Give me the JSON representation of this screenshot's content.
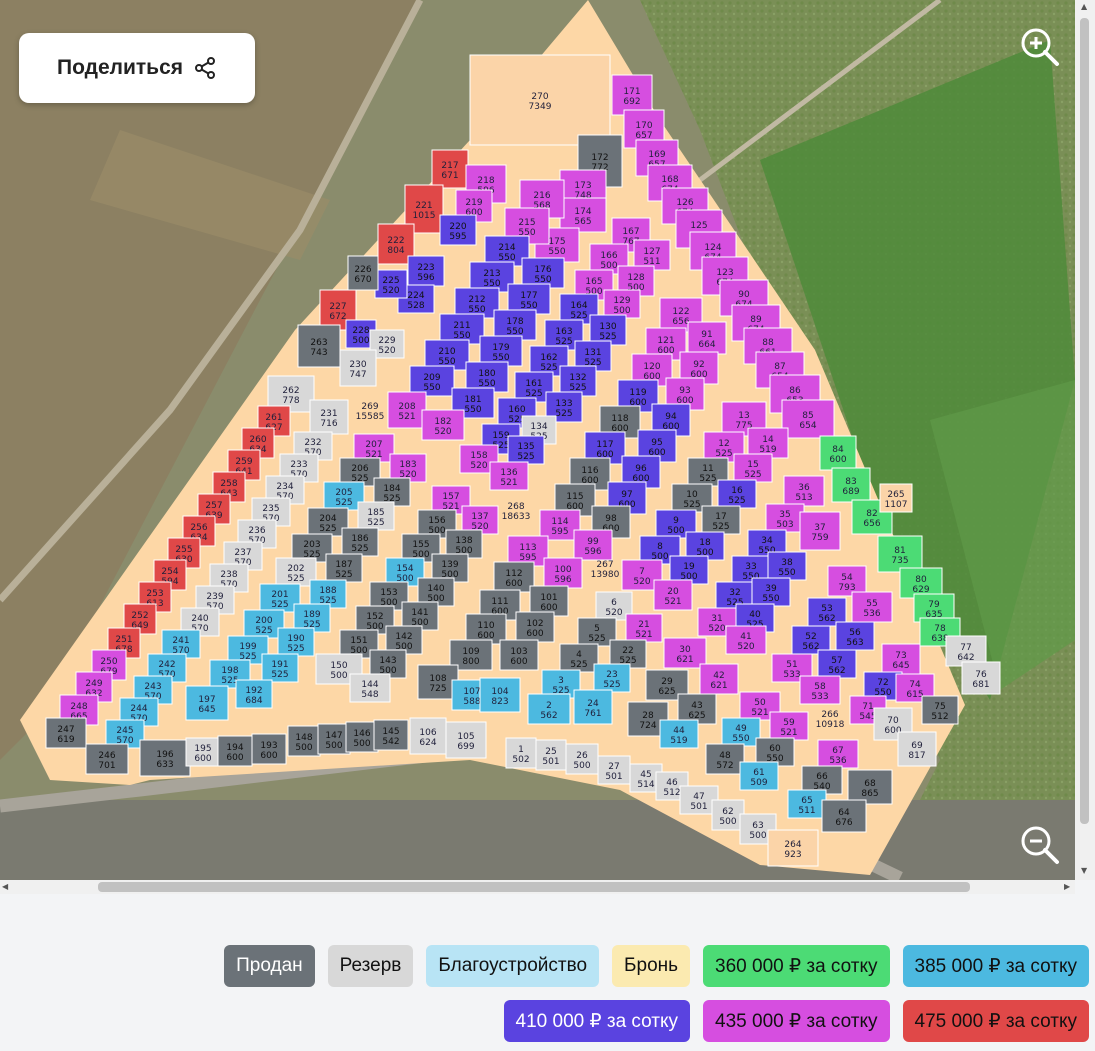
{
  "share": {
    "label": "Поделиться"
  },
  "legend": {
    "row1": [
      {
        "label": "Продан",
        "color": "#6b7278",
        "dark": true
      },
      {
        "label": "Резерв",
        "color": "#d8d8d8",
        "dark": false
      },
      {
        "label": "Благоустройство",
        "color": "#b8e4f5",
        "dark": false
      },
      {
        "label": "Бронь",
        "color": "#fbeab0",
        "dark": false
      },
      {
        "label": "360 000 ₽ за сотку",
        "color": "#4cdb75",
        "dark": false
      },
      {
        "label": "385 000 ₽ за сотку",
        "color": "#4cb9e0",
        "dark": false
      }
    ],
    "row2": [
      {
        "label": "410 000 ₽ за сотку",
        "color": "#5a43e0",
        "dark": true
      },
      {
        "label": "435 000 ₽ за сотку",
        "color": "#d64ee0",
        "dark": false
      },
      {
        "label": "475 000 ₽ за сотку",
        "color": "#e04848",
        "dark": false
      }
    ]
  },
  "colors": {
    "sold": "#6b7278",
    "reserve": "#d8d8d8",
    "booked": "#fbd4a8",
    "p360": "#4cdb75",
    "p385": "#4cb9e0",
    "p410": "#5a43e0",
    "p435": "#d64ee0",
    "p475": "#e04848"
  },
  "plots": [
    {
      "n": "270",
      "a": "7349",
      "s": "booked"
    },
    {
      "n": "171",
      "a": "692",
      "s": "p435"
    },
    {
      "n": "170",
      "a": "657",
      "s": "p435"
    },
    {
      "n": "169",
      "a": "657",
      "s": "p435"
    },
    {
      "n": "168",
      "a": "674",
      "s": "p435"
    },
    {
      "n": "126",
      "a": "674",
      "s": "p435"
    },
    {
      "n": "125",
      "a": "674",
      "s": "p435"
    },
    {
      "n": "124",
      "a": "674",
      "s": "p435"
    },
    {
      "n": "123",
      "a": "674",
      "s": "p435"
    },
    {
      "n": "90",
      "a": "674",
      "s": "p435"
    },
    {
      "n": "89",
      "a": "674",
      "s": "p435"
    },
    {
      "n": "88",
      "a": "661",
      "s": "p435"
    },
    {
      "n": "87",
      "a": "654",
      "s": "p435"
    },
    {
      "n": "86",
      "a": "653",
      "s": "p435"
    },
    {
      "n": "85",
      "a": "654",
      "s": "p435"
    },
    {
      "n": "172",
      "a": "772",
      "s": "sold"
    },
    {
      "n": "173",
      "a": "748",
      "s": "p435"
    },
    {
      "n": "174",
      "a": "565",
      "s": "p435"
    },
    {
      "n": "175",
      "a": "550",
      "s": "p435"
    },
    {
      "n": "216",
      "a": "568",
      "s": "p435"
    },
    {
      "n": "215",
      "a": "550",
      "s": "p435"
    },
    {
      "n": "217",
      "a": "671",
      "s": "p475"
    },
    {
      "n": "218",
      "a": "596",
      "s": "p435"
    },
    {
      "n": "219",
      "a": "600",
      "s": "p435"
    },
    {
      "n": "221",
      "a": "1015",
      "s": "p475"
    },
    {
      "n": "220",
      "a": "595",
      "s": "p410"
    },
    {
      "n": "222",
      "a": "804",
      "s": "p475"
    },
    {
      "n": "223",
      "a": "596",
      "s": "p410"
    },
    {
      "n": "224",
      "a": "528",
      "s": "p410"
    },
    {
      "n": "225",
      "a": "520",
      "s": "p410"
    },
    {
      "n": "226",
      "a": "670",
      "s": "sold"
    },
    {
      "n": "227",
      "a": "672",
      "s": "p475"
    },
    {
      "n": "228",
      "a": "500",
      "s": "p410"
    },
    {
      "n": "229",
      "a": "520",
      "s": "reserve"
    },
    {
      "n": "230",
      "a": "747",
      "s": "reserve"
    },
    {
      "n": "263",
      "a": "743",
      "s": "sold"
    },
    {
      "n": "214",
      "a": "550",
      "s": "p410"
    },
    {
      "n": "176",
      "a": "550",
      "s": "p410"
    },
    {
      "n": "213",
      "a": "550",
      "s": "p410"
    },
    {
      "n": "177",
      "a": "550",
      "s": "p410"
    },
    {
      "n": "212",
      "a": "550",
      "s": "p410"
    },
    {
      "n": "178",
      "a": "550",
      "s": "p410"
    },
    {
      "n": "211",
      "a": "550",
      "s": "p410"
    },
    {
      "n": "179",
      "a": "550",
      "s": "p410"
    },
    {
      "n": "210",
      "a": "550",
      "s": "p410"
    },
    {
      "n": "180",
      "a": "550",
      "s": "p410"
    },
    {
      "n": "209",
      "a": "550",
      "s": "p410"
    },
    {
      "n": "181",
      "a": "550",
      "s": "p410"
    },
    {
      "n": "208",
      "a": "521",
      "s": "p435"
    },
    {
      "n": "182",
      "a": "520",
      "s": "p435"
    },
    {
      "n": "167",
      "a": "767",
      "s": "p435"
    },
    {
      "n": "127",
      "a": "511",
      "s": "p435"
    },
    {
      "n": "166",
      "a": "500",
      "s": "p435"
    },
    {
      "n": "128",
      "a": "500",
      "s": "p435"
    },
    {
      "n": "165",
      "a": "500",
      "s": "p435"
    },
    {
      "n": "129",
      "a": "500",
      "s": "p435"
    },
    {
      "n": "164",
      "a": "525",
      "s": "p410"
    },
    {
      "n": "130",
      "a": "525",
      "s": "p410"
    },
    {
      "n": "163",
      "a": "525",
      "s": "p410"
    },
    {
      "n": "131",
      "a": "525",
      "s": "p410"
    },
    {
      "n": "162",
      "a": "525",
      "s": "p410"
    },
    {
      "n": "132",
      "a": "525",
      "s": "p410"
    },
    {
      "n": "161",
      "a": "525",
      "s": "p410"
    },
    {
      "n": "133",
      "a": "525",
      "s": "p410"
    },
    {
      "n": "160",
      "a": "525",
      "s": "p410"
    },
    {
      "n": "134",
      "a": "525",
      "s": "reserve"
    },
    {
      "n": "159",
      "a": "525",
      "s": "p410"
    },
    {
      "n": "135",
      "a": "525",
      "s": "p410"
    },
    {
      "n": "158",
      "a": "520",
      "s": "p435"
    },
    {
      "n": "136",
      "a": "521",
      "s": "p435"
    },
    {
      "n": "122",
      "a": "656",
      "s": "p435"
    },
    {
      "n": "91",
      "a": "664",
      "s": "p435"
    },
    {
      "n": "121",
      "a": "600",
      "s": "p435"
    },
    {
      "n": "92",
      "a": "600",
      "s": "p435"
    },
    {
      "n": "120",
      "a": "600",
      "s": "p435"
    },
    {
      "n": "93",
      "a": "600",
      "s": "p435"
    },
    {
      "n": "119",
      "a": "600",
      "s": "p410"
    },
    {
      "n": "94",
      "a": "600",
      "s": "p410"
    },
    {
      "n": "118",
      "a": "600",
      "s": "sold"
    },
    {
      "n": "95",
      "a": "600",
      "s": "p410"
    },
    {
      "n": "117",
      "a": "600",
      "s": "p410"
    },
    {
      "n": "96",
      "a": "600",
      "s": "p410"
    },
    {
      "n": "116",
      "a": "600",
      "s": "sold"
    },
    {
      "n": "97",
      "a": "600",
      "s": "p410"
    },
    {
      "n": "115",
      "a": "600",
      "s": "sold"
    },
    {
      "n": "98",
      "a": "600",
      "s": "sold"
    },
    {
      "n": "114",
      "a": "595",
      "s": "p435"
    },
    {
      "n": "99",
      "a": "596",
      "s": "p435"
    },
    {
      "n": "262",
      "a": "778",
      "s": "reserve"
    },
    {
      "n": "231",
      "a": "716",
      "s": "reserve"
    },
    {
      "n": "261",
      "a": "627",
      "s": "p475"
    },
    {
      "n": "232",
      "a": "570",
      "s": "reserve"
    },
    {
      "n": "260",
      "a": "634",
      "s": "p475"
    },
    {
      "n": "233",
      "a": "570",
      "s": "reserve"
    },
    {
      "n": "259",
      "a": "641",
      "s": "p475"
    },
    {
      "n": "234",
      "a": "570",
      "s": "reserve"
    },
    {
      "n": "258",
      "a": "643",
      "s": "p475"
    },
    {
      "n": "235",
      "a": "570",
      "s": "reserve"
    },
    {
      "n": "257",
      "a": "639",
      "s": "p475"
    },
    {
      "n": "236",
      "a": "570",
      "s": "reserve"
    },
    {
      "n": "256",
      "a": "634",
      "s": "p475"
    },
    {
      "n": "237",
      "a": "570",
      "s": "reserve"
    },
    {
      "n": "255",
      "a": "630",
      "s": "p475"
    },
    {
      "n": "238",
      "a": "570",
      "s": "reserve"
    },
    {
      "n": "254",
      "a": "594",
      "s": "p475"
    },
    {
      "n": "239",
      "a": "570",
      "s": "reserve"
    },
    {
      "n": "253",
      "a": "613",
      "s": "p475"
    },
    {
      "n": "240",
      "a": "570",
      "s": "reserve"
    },
    {
      "n": "252",
      "a": "649",
      "s": "p475"
    },
    {
      "n": "241",
      "a": "570",
      "s": "p385"
    },
    {
      "n": "251",
      "a": "678",
      "s": "p475"
    },
    {
      "n": "242",
      "a": "570",
      "s": "p385"
    },
    {
      "n": "250",
      "a": "679",
      "s": "p435"
    },
    {
      "n": "243",
      "a": "570",
      "s": "p385"
    },
    {
      "n": "249",
      "a": "632",
      "s": "p435"
    },
    {
      "n": "244",
      "a": "570",
      "s": "p385"
    },
    {
      "n": "248",
      "a": "665",
      "s": "p435"
    },
    {
      "n": "245",
      "a": "570",
      "s": "p385"
    },
    {
      "n": "247",
      "a": "619",
      "s": "sold"
    },
    {
      "n": "246",
      "a": "701",
      "s": "sold"
    },
    {
      "n": "207",
      "a": "521",
      "s": "p435"
    },
    {
      "n": "183",
      "a": "520",
      "s": "p435"
    },
    {
      "n": "206",
      "a": "525",
      "s": "sold"
    },
    {
      "n": "184",
      "a": "525",
      "s": "sold"
    },
    {
      "n": "205",
      "a": "525",
      "s": "p385"
    },
    {
      "n": "185",
      "a": "525",
      "s": "reserve"
    },
    {
      "n": "204",
      "a": "525",
      "s": "sold"
    },
    {
      "n": "186",
      "a": "525",
      "s": "sold"
    },
    {
      "n": "203",
      "a": "525",
      "s": "sold"
    },
    {
      "n": "187",
      "a": "525",
      "s": "sold"
    },
    {
      "n": "202",
      "a": "525",
      "s": "reserve"
    },
    {
      "n": "188",
      "a": "525",
      "s": "p385"
    },
    {
      "n": "201",
      "a": "525",
      "s": "p385"
    },
    {
      "n": "189",
      "a": "525",
      "s": "p385"
    },
    {
      "n": "200",
      "a": "525",
      "s": "p385"
    },
    {
      "n": "190",
      "a": "525",
      "s": "p385"
    },
    {
      "n": "199",
      "a": "525",
      "s": "p385"
    },
    {
      "n": "191",
      "a": "525",
      "s": "p385"
    },
    {
      "n": "198",
      "a": "525",
      "s": "p385"
    },
    {
      "n": "192",
      "a": "684",
      "s": "p385"
    },
    {
      "n": "197",
      "a": "645",
      "s": "p385"
    },
    {
      "n": "157",
      "a": "521",
      "s": "p435"
    },
    {
      "n": "137",
      "a": "520",
      "s": "p435"
    },
    {
      "n": "156",
      "a": "500",
      "s": "sold"
    },
    {
      "n": "138",
      "a": "500",
      "s": "sold"
    },
    {
      "n": "155",
      "a": "500",
      "s": "sold"
    },
    {
      "n": "139",
      "a": "500",
      "s": "sold"
    },
    {
      "n": "154",
      "a": "500",
      "s": "p385"
    },
    {
      "n": "140",
      "a": "500",
      "s": "sold"
    },
    {
      "n": "153",
      "a": "500",
      "s": "sold"
    },
    {
      "n": "141",
      "a": "500",
      "s": "sold"
    },
    {
      "n": "152",
      "a": "500",
      "s": "sold"
    },
    {
      "n": "142",
      "a": "500",
      "s": "sold"
    },
    {
      "n": "151",
      "a": "500",
      "s": "sold"
    },
    {
      "n": "143",
      "a": "500",
      "s": "sold"
    },
    {
      "n": "150",
      "a": "500",
      "s": "reserve"
    },
    {
      "n": "144",
      "a": "548",
      "s": "reserve"
    },
    {
      "n": "113",
      "a": "595",
      "s": "p435"
    },
    {
      "n": "100",
      "a": "596",
      "s": "p435"
    },
    {
      "n": "112",
      "a": "600",
      "s": "sold"
    },
    {
      "n": "101",
      "a": "600",
      "s": "sold"
    },
    {
      "n": "111",
      "a": "600",
      "s": "sold"
    },
    {
      "n": "102",
      "a": "600",
      "s": "sold"
    },
    {
      "n": "110",
      "a": "600",
      "s": "sold"
    },
    {
      "n": "103",
      "a": "600",
      "s": "sold"
    },
    {
      "n": "109",
      "a": "800",
      "s": "sold"
    },
    {
      "n": "108",
      "a": "725",
      "s": "sold"
    },
    {
      "n": "107",
      "a": "588",
      "s": "p385"
    },
    {
      "n": "104",
      "a": "823",
      "s": "p385"
    },
    {
      "n": "13",
      "a": "775",
      "s": "p435"
    },
    {
      "n": "14",
      "a": "519",
      "s": "p435"
    },
    {
      "n": "12",
      "a": "525",
      "s": "p435"
    },
    {
      "n": "15",
      "a": "525",
      "s": "p435"
    },
    {
      "n": "11",
      "a": "525",
      "s": "sold"
    },
    {
      "n": "16",
      "a": "525",
      "s": "p410"
    },
    {
      "n": "10",
      "a": "525",
      "s": "sold"
    },
    {
      "n": "17",
      "a": "525",
      "s": "sold"
    },
    {
      "n": "9",
      "a": "500",
      "s": "p410"
    },
    {
      "n": "18",
      "a": "500",
      "s": "p410"
    },
    {
      "n": "8",
      "a": "500",
      "s": "p410"
    },
    {
      "n": "19",
      "a": "500",
      "s": "p410"
    },
    {
      "n": "7",
      "a": "520",
      "s": "p435"
    },
    {
      "n": "20",
      "a": "521",
      "s": "p435"
    },
    {
      "n": "36",
      "a": "513",
      "s": "p435"
    },
    {
      "n": "35",
      "a": "503",
      "s": "p435"
    },
    {
      "n": "37",
      "a": "759",
      "s": "p435"
    },
    {
      "n": "34",
      "a": "550",
      "s": "p410"
    },
    {
      "n": "33",
      "a": "550",
      "s": "p410"
    },
    {
      "n": "38",
      "a": "550",
      "s": "p410"
    },
    {
      "n": "32",
      "a": "525",
      "s": "p410"
    },
    {
      "n": "39",
      "a": "550",
      "s": "p410"
    },
    {
      "n": "31",
      "a": "520",
      "s": "p435"
    },
    {
      "n": "40",
      "a": "525",
      "s": "p410"
    },
    {
      "n": "41",
      "a": "520",
      "s": "p435"
    },
    {
      "n": "54",
      "a": "793",
      "s": "p435"
    },
    {
      "n": "55",
      "a": "536",
      "s": "p435"
    },
    {
      "n": "53",
      "a": "562",
      "s": "p410"
    },
    {
      "n": "56",
      "a": "563",
      "s": "p410"
    },
    {
      "n": "52",
      "a": "562",
      "s": "p410"
    },
    {
      "n": "57",
      "a": "562",
      "s": "p410"
    },
    {
      "n": "51",
      "a": "533",
      "s": "p435"
    },
    {
      "n": "58",
      "a": "533",
      "s": "p435"
    },
    {
      "n": "84",
      "a": "600",
      "s": "p360"
    },
    {
      "n": "83",
      "a": "689",
      "s": "p360"
    },
    {
      "n": "82",
      "a": "656",
      "s": "p360"
    },
    {
      "n": "81",
      "a": "735",
      "s": "p360"
    },
    {
      "n": "80",
      "a": "629",
      "s": "p360"
    },
    {
      "n": "79",
      "a": "635",
      "s": "p360"
    },
    {
      "n": "78",
      "a": "638",
      "s": "p360"
    },
    {
      "n": "77",
      "a": "642",
      "s": "reserve"
    },
    {
      "n": "76",
      "a": "681",
      "s": "reserve"
    },
    {
      "n": "265",
      "a": "1107",
      "s": "booked"
    },
    {
      "n": "73",
      "a": "645",
      "s": "p435"
    },
    {
      "n": "72",
      "a": "550",
      "s": "p410"
    },
    {
      "n": "74",
      "a": "615",
      "s": "p435"
    },
    {
      "n": "71",
      "a": "545",
      "s": "p435"
    },
    {
      "n": "75",
      "a": "512",
      "s": "sold"
    },
    {
      "n": "70",
      "a": "600",
      "s": "reserve"
    },
    {
      "n": "69",
      "a": "817",
      "s": "reserve"
    },
    {
      "n": "6",
      "a": "520",
      "s": "reserve"
    },
    {
      "n": "21",
      "a": "521",
      "s": "p435"
    },
    {
      "n": "5",
      "a": "525",
      "s": "sold"
    },
    {
      "n": "22",
      "a": "525",
      "s": "sold"
    },
    {
      "n": "4",
      "a": "525",
      "s": "sold"
    },
    {
      "n": "23",
      "a": "525",
      "s": "p385"
    },
    {
      "n": "3",
      "a": "525",
      "s": "p385"
    },
    {
      "n": "24",
      "a": "761",
      "s": "p385"
    },
    {
      "n": "2",
      "a": "562",
      "s": "p385"
    },
    {
      "n": "30",
      "a": "621",
      "s": "p435"
    },
    {
      "n": "42",
      "a": "621",
      "s": "p435"
    },
    {
      "n": "29",
      "a": "625",
      "s": "sold"
    },
    {
      "n": "43",
      "a": "625",
      "s": "sold"
    },
    {
      "n": "28",
      "a": "724",
      "s": "sold"
    },
    {
      "n": "44",
      "a": "519",
      "s": "p385"
    },
    {
      "n": "50",
      "a": "521",
      "s": "p435"
    },
    {
      "n": "59",
      "a": "521",
      "s": "p435"
    },
    {
      "n": "49",
      "a": "550",
      "s": "p385"
    },
    {
      "n": "60",
      "a": "550",
      "s": "sold"
    },
    {
      "n": "48",
      "a": "572",
      "s": "sold"
    },
    {
      "n": "61",
      "a": "509",
      "s": "p385"
    },
    {
      "n": "67",
      "a": "536",
      "s": "p435"
    },
    {
      "n": "66",
      "a": "540",
      "s": "sold"
    },
    {
      "n": "68",
      "a": "865",
      "s": "sold"
    },
    {
      "n": "65",
      "a": "511",
      "s": "p385"
    },
    {
      "n": "64",
      "a": "676",
      "s": "sold"
    },
    {
      "n": "196",
      "a": "633",
      "s": "sold"
    },
    {
      "n": "195",
      "a": "600",
      "s": "reserve"
    },
    {
      "n": "194",
      "a": "600",
      "s": "sold"
    },
    {
      "n": "193",
      "a": "600",
      "s": "sold"
    },
    {
      "n": "148",
      "a": "500",
      "s": "sold"
    },
    {
      "n": "147",
      "a": "500",
      "s": "sold"
    },
    {
      "n": "146",
      "a": "500",
      "s": "sold"
    },
    {
      "n": "145",
      "a": "542",
      "s": "sold"
    },
    {
      "n": "106",
      "a": "624",
      "s": "reserve"
    },
    {
      "n": "105",
      "a": "699",
      "s": "reserve"
    },
    {
      "n": "1",
      "a": "502",
      "s": "reserve"
    },
    {
      "n": "25",
      "a": "501",
      "s": "reserve"
    },
    {
      "n": "26",
      "a": "500",
      "s": "reserve"
    },
    {
      "n": "27",
      "a": "501",
      "s": "reserve"
    },
    {
      "n": "45",
      "a": "514",
      "s": "reserve"
    },
    {
      "n": "46",
      "a": "512",
      "s": "reserve"
    },
    {
      "n": "47",
      "a": "501",
      "s": "reserve"
    },
    {
      "n": "62",
      "a": "500",
      "s": "reserve"
    },
    {
      "n": "63",
      "a": "500",
      "s": "reserve"
    },
    {
      "n": "264",
      "a": "923",
      "s": "booked"
    },
    {
      "n": "269",
      "a": "15585",
      "s": "road"
    },
    {
      "n": "268",
      "a": "18633",
      "s": "road"
    },
    {
      "n": "267",
      "a": "13980",
      "s": "road"
    },
    {
      "n": "266",
      "a": "10918",
      "s": "road"
    }
  ]
}
